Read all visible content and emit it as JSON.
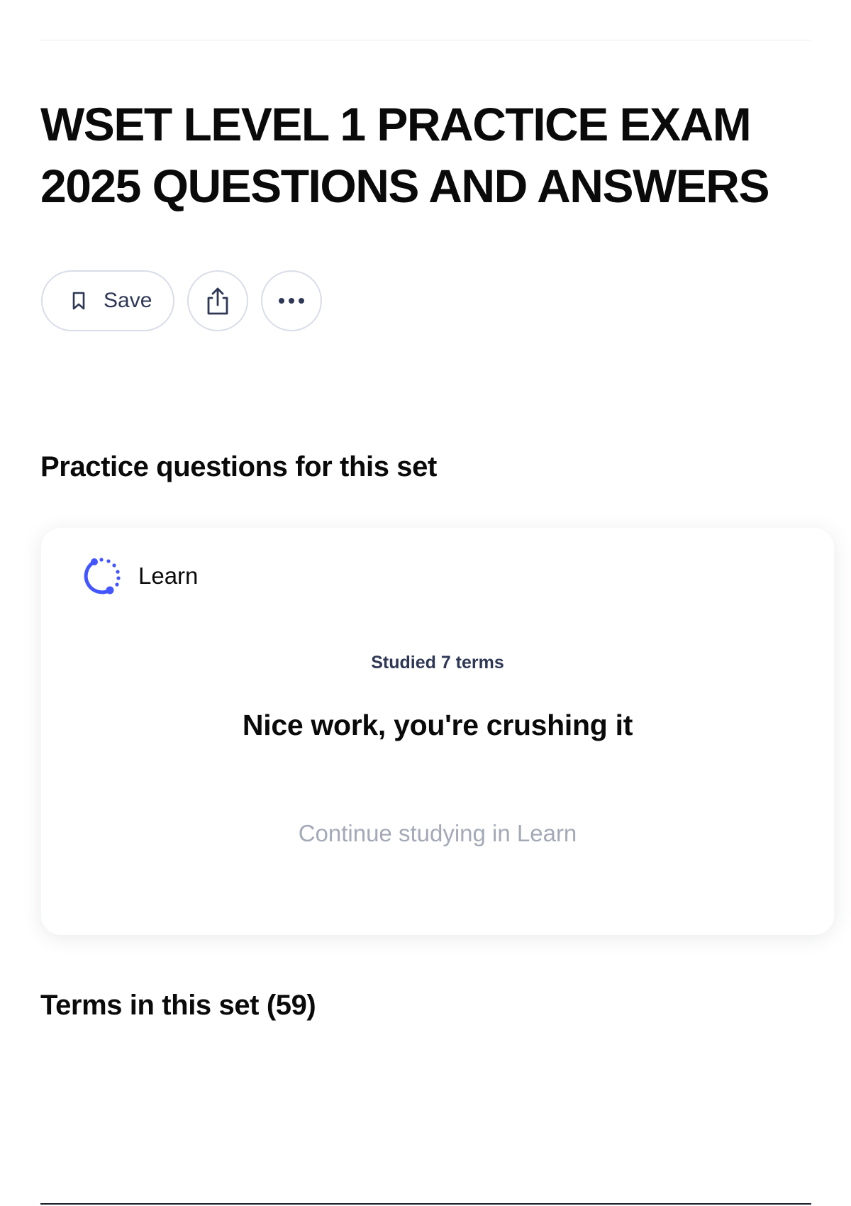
{
  "header": {
    "title_line1": "WSET LEVEL 1 PRACTICE EXAM",
    "title_line2": "2025 QUESTIONS AND ANSWERS"
  },
  "actions": {
    "save_label": "Save",
    "save_icon": "bookmark-icon",
    "share_icon": "share-icon",
    "more_icon": "more-horizontal-icon"
  },
  "practice": {
    "heading": "Practice questions for this set",
    "card": {
      "mode_label": "Learn",
      "mode_icon": "learn-progress-icon",
      "studied_text": "Studied 7 terms",
      "message": "Nice work, you're crushing it",
      "continue_label": "Continue studying in Learn"
    }
  },
  "terms": {
    "heading": "Terms in this set (59)"
  },
  "colors": {
    "accent": "#4255ff",
    "text_primary": "#0a0a0a",
    "text_secondary": "#2e3856",
    "text_muted": "#a3a9b6",
    "border": "#d9dde8"
  }
}
